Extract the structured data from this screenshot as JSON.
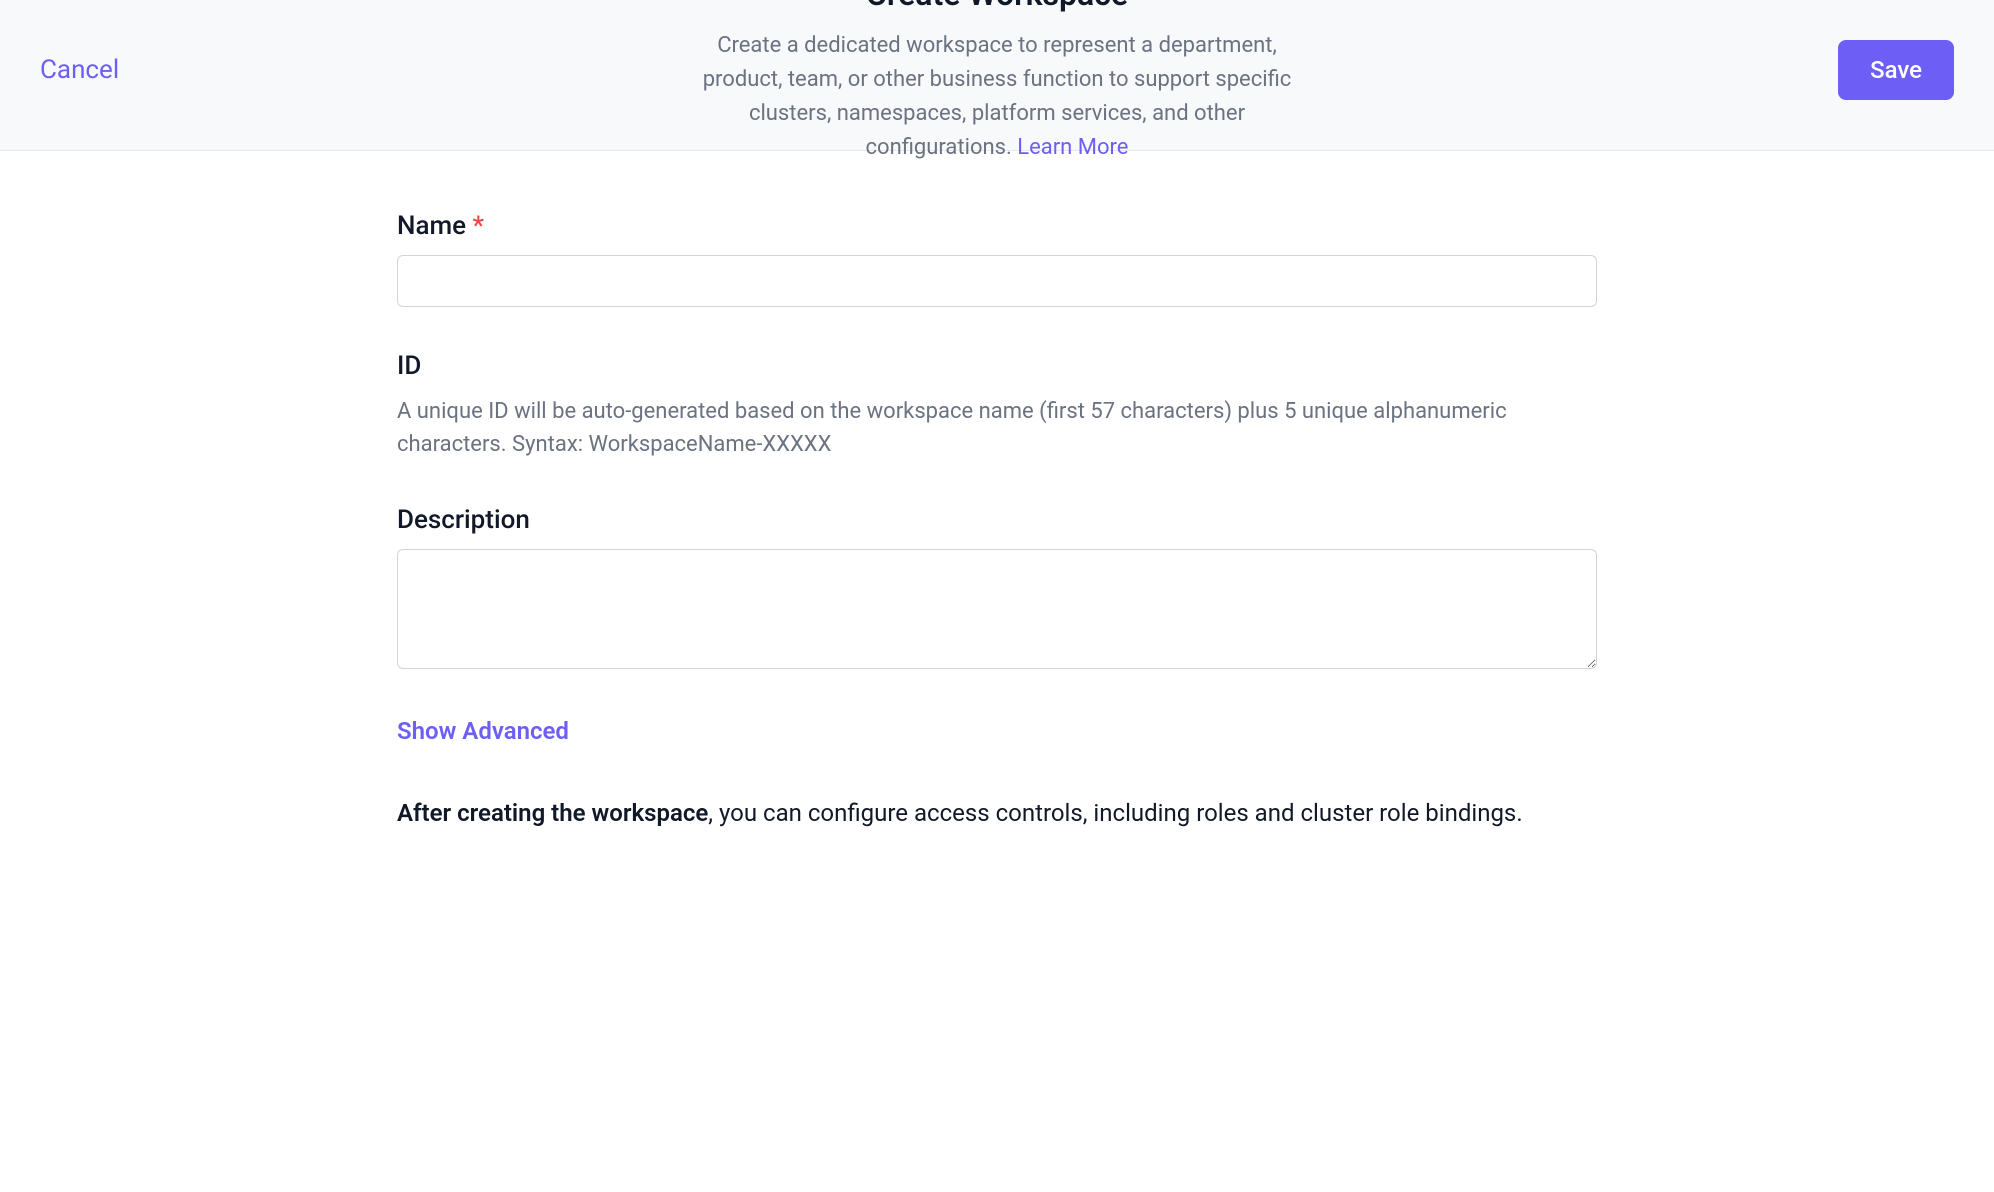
{
  "header": {
    "cancel_label": "Cancel",
    "title": "Create Workspace",
    "description": "Create a dedicated workspace to represent a department, product, team, or other business function to support specific clusters, namespaces, platform services, and other configurations. ",
    "learn_more_label": "Learn More",
    "save_label": "Save"
  },
  "form": {
    "name": {
      "label": "Name ",
      "required_marker": "*",
      "value": ""
    },
    "id": {
      "label": "ID",
      "helper": "A unique ID will be auto-generated based on the workspace name (first 57 characters) plus 5 unique alphanumeric characters. Syntax: WorkspaceName-XXXXX"
    },
    "description": {
      "label": "Description",
      "value": ""
    },
    "show_advanced_label": "Show Advanced",
    "footer_note_bold": "After creating the workspace",
    "footer_note_rest": ", you can configure access controls, including roles and cluster role bindings."
  }
}
